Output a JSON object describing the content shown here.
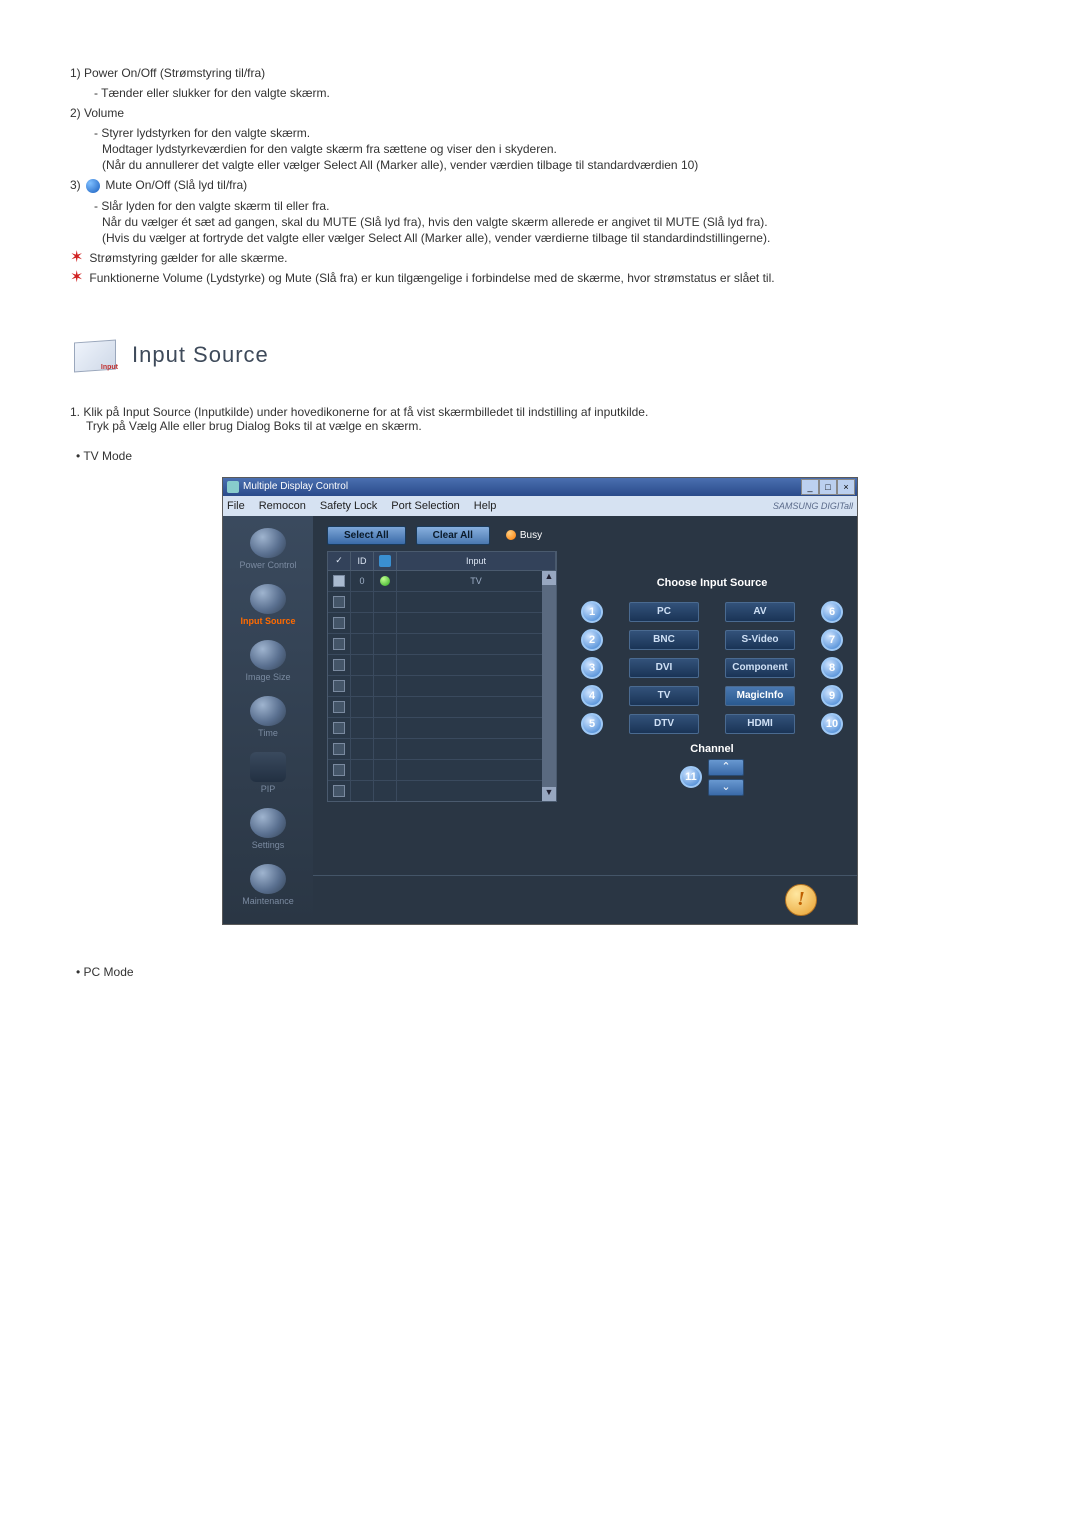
{
  "list": {
    "item1_title": "1)  Power On/Off (Strømstyring til/fra)",
    "item1_sub1": "- Tænder eller slukker for den valgte skærm.",
    "item2_title": "2)  Volume",
    "item2_sub1": "- Styrer lydstyrken for den valgte skærm.",
    "item2_sub2": "Modtager lydstyrkeværdien for den valgte skærm fra sættene og viser den i skyderen.",
    "item2_sub3": "(Når du annullerer det valgte eller vælger Select All (Marker alle), vender værdien tilbage til standardværdien 10)",
    "item3_prefix": "3)",
    "item3_title": " Mute On/Off (Slå lyd til/fra)",
    "item3_sub1": "- Slår lyden for den valgte skærm til eller fra.",
    "item3_sub2": "Når du vælger ét sæt ad gangen, skal du MUTE (Slå lyd fra), hvis den valgte skærm allerede er angivet til MUTE (Slå lyd fra).",
    "item3_sub3": "(Hvis du vælger at fortryde det valgte eller vælger Select All (Marker alle), vender værdierne tilbage til standardindstillingerne).",
    "star1": "Strømstyring gælder for alle skærme.",
    "star2": "Funktionerne Volume (Lydstyrke) og Mute (Slå fra) er kun tilgængelige i forbindelse med de skærme, hvor strømstatus er slået til."
  },
  "section": {
    "icon_label": "Input",
    "title": "Input Source"
  },
  "instructions": {
    "line1": "1.  Klik på Input Source (Inputkilde) under hovedikonerne for at få vist skærmbilledet til indstilling af inputkilde.",
    "line2": "Tryk på Vælg Alle eller brug Dialog Boks til at vælge en skærm.",
    "tv_mode": "• TV Mode",
    "pc_mode": "• PC Mode"
  },
  "app": {
    "title": "Multiple Display Control",
    "menu": {
      "file": "File",
      "remocon": "Remocon",
      "safety": "Safety Lock",
      "port": "Port Selection",
      "help": "Help"
    },
    "brand": "SAMSUNG DIGITall",
    "sidebar": {
      "power": "Power Control",
      "input": "Input Source",
      "image": "Image Size",
      "time": "Time",
      "pip": "PIP",
      "settings": "Settings",
      "maint": "Maintenance"
    },
    "controls": {
      "select_all": "Select All",
      "clear_all": "Clear All",
      "busy": "Busy"
    },
    "grid": {
      "hdr_chk": "✓",
      "hdr_id": "ID",
      "hdr_stat": "",
      "hdr_input": "Input",
      "row0_id": "0",
      "row0_input": "TV"
    },
    "right": {
      "choose": "Choose Input Source",
      "pc": "PC",
      "av": "AV",
      "bnc": "BNC",
      "svideo": "S-Video",
      "dvi": "DVI",
      "component": "Component",
      "tv": "TV",
      "magic": "MagicInfo",
      "dtv": "DTV",
      "hdmi": "HDMI",
      "channel": "Channel"
    },
    "badges": {
      "n1": "1",
      "n2": "2",
      "n3": "3",
      "n4": "4",
      "n5": "5",
      "n6": "6",
      "n7": "7",
      "n8": "8",
      "n9": "9",
      "n10": "10",
      "n11": "11"
    }
  }
}
